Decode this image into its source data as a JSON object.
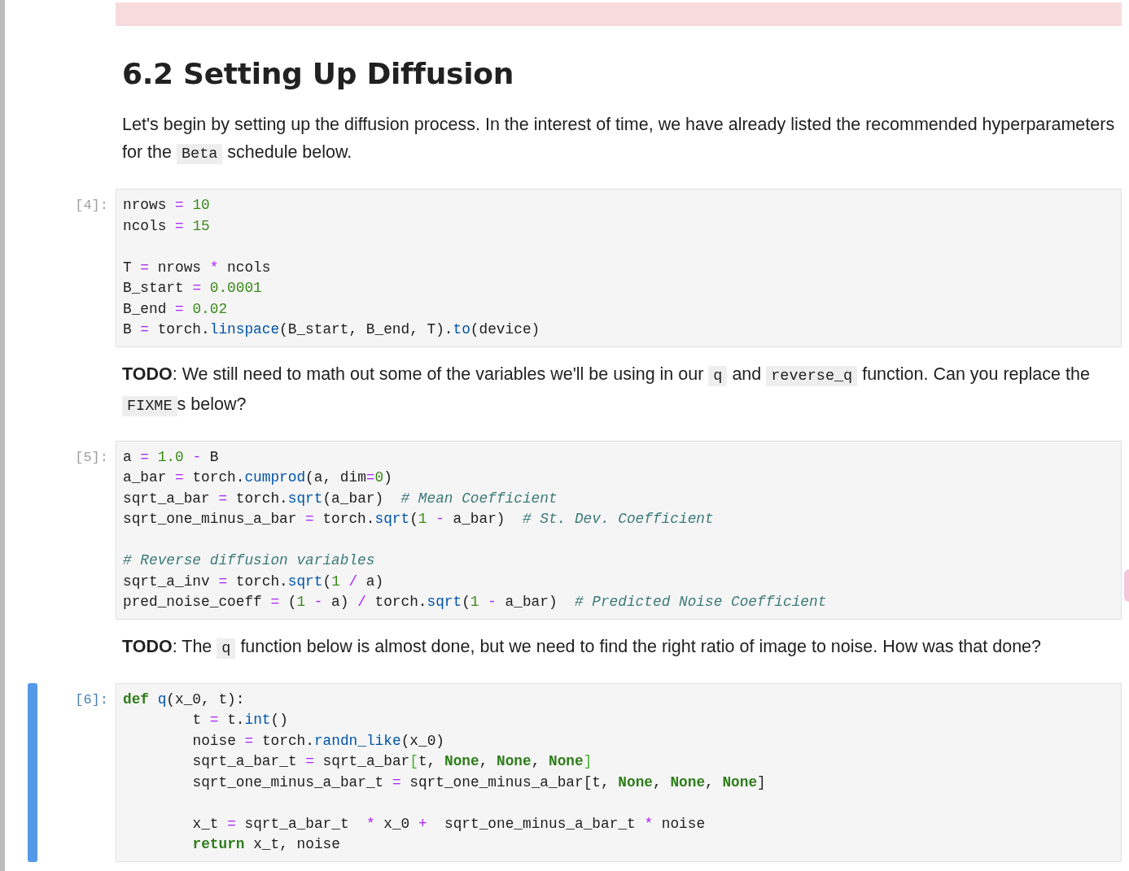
{
  "cells": [
    {
      "kind": "stderr_output",
      "selected": false
    },
    {
      "kind": "markdown",
      "selected": false,
      "heading": "6.2 Setting Up Diffusion",
      "paragraph": [
        {
          "kind": "text",
          "text": "Let's begin by setting up the diffusion process. In the interest of time, we have already listed the recommended hyperparameters for the "
        },
        {
          "kind": "code",
          "text": "Beta"
        },
        {
          "kind": "text",
          "text": " schedule below."
        }
      ]
    },
    {
      "kind": "code",
      "selected": false,
      "prompt": "[4]:",
      "lines": [
        {
          "tokens": [
            {
              "kind": "plain",
              "text": "nrows "
            },
            {
              "kind": "op",
              "text": "= "
            },
            {
              "kind": "number",
              "text": "10"
            }
          ]
        },
        {
          "tokens": [
            {
              "kind": "plain",
              "text": "ncols "
            },
            {
              "kind": "op",
              "text": "= "
            },
            {
              "kind": "number",
              "text": "15"
            }
          ]
        },
        {
          "blank_before": true,
          "tokens": [
            {
              "kind": "plain",
              "text": "T "
            },
            {
              "kind": "op",
              "text": "= "
            },
            {
              "kind": "plain",
              "text": "nrows "
            },
            {
              "kind": "op",
              "text": "* "
            },
            {
              "kind": "plain",
              "text": "ncols"
            }
          ]
        },
        {
          "tokens": [
            {
              "kind": "plain",
              "text": "B_start "
            },
            {
              "kind": "op",
              "text": "= "
            },
            {
              "kind": "number",
              "text": "0.0001"
            }
          ]
        },
        {
          "tokens": [
            {
              "kind": "plain",
              "text": "B_end "
            },
            {
              "kind": "op",
              "text": "= "
            },
            {
              "kind": "number",
              "text": "0.02"
            }
          ]
        },
        {
          "tokens": [
            {
              "kind": "plain",
              "text": "B "
            },
            {
              "kind": "op",
              "text": "= "
            },
            {
              "kind": "plain",
              "text": "torch."
            },
            {
              "kind": "func",
              "text": "linspace"
            },
            {
              "kind": "plain",
              "text": "(B_start, B_end, T)."
            },
            {
              "kind": "func",
              "text": "to"
            },
            {
              "kind": "plain",
              "text": "(device)"
            }
          ]
        }
      ]
    },
    {
      "kind": "markdown",
      "selected": false,
      "paragraph": [
        {
          "kind": "bold",
          "text": "TODO"
        },
        {
          "kind": "text",
          "text": ": We still need to math out some of the variables we'll be using in our "
        },
        {
          "kind": "code",
          "text": "q"
        },
        {
          "kind": "text",
          "text": " and "
        },
        {
          "kind": "code",
          "text": "reverse_q"
        },
        {
          "kind": "text",
          "text": " function. Can you replace the "
        },
        {
          "kind": "code",
          "text": "FIXME"
        },
        {
          "kind": "text",
          "text": "s below?"
        }
      ]
    },
    {
      "kind": "code",
      "selected": false,
      "prompt": "[5]:",
      "lines": [
        {
          "tokens": [
            {
              "kind": "plain",
              "text": "a "
            },
            {
              "kind": "op",
              "text": "= "
            },
            {
              "kind": "number",
              "text": "1.0 "
            },
            {
              "kind": "op",
              "text": "- "
            },
            {
              "kind": "plain",
              "text": "B"
            }
          ]
        },
        {
          "tokens": [
            {
              "kind": "plain",
              "text": "a_bar "
            },
            {
              "kind": "op",
              "text": "= "
            },
            {
              "kind": "plain",
              "text": "torch."
            },
            {
              "kind": "func",
              "text": "cumprod"
            },
            {
              "kind": "plain",
              "text": "(a, dim"
            },
            {
              "kind": "op",
              "text": "="
            },
            {
              "kind": "number",
              "text": "0"
            },
            {
              "kind": "plain",
              "text": ")"
            }
          ]
        },
        {
          "tokens": [
            {
              "kind": "plain",
              "text": "sqrt_a_bar "
            },
            {
              "kind": "op",
              "text": "= "
            },
            {
              "kind": "plain",
              "text": "torch."
            },
            {
              "kind": "func",
              "text": "sqrt"
            },
            {
              "kind": "plain",
              "text": "(a_bar)  "
            },
            {
              "kind": "comment",
              "text": "# Mean Coefficient"
            }
          ]
        },
        {
          "tokens": [
            {
              "kind": "plain",
              "text": "sqrt_one_minus_a_bar "
            },
            {
              "kind": "op",
              "text": "= "
            },
            {
              "kind": "plain",
              "text": "torch."
            },
            {
              "kind": "func",
              "text": "sqrt"
            },
            {
              "kind": "plain",
              "text": "("
            },
            {
              "kind": "number",
              "text": "1 "
            },
            {
              "kind": "op",
              "text": "- "
            },
            {
              "kind": "plain",
              "text": "a_bar)  "
            },
            {
              "kind": "comment",
              "text": "# St. Dev. Coefficient"
            }
          ]
        },
        {
          "blank_before": true,
          "tokens": [
            {
              "kind": "comment",
              "text": "# Reverse diffusion variables"
            }
          ]
        },
        {
          "tokens": [
            {
              "kind": "plain",
              "text": "sqrt_a_inv "
            },
            {
              "kind": "op",
              "text": "= "
            },
            {
              "kind": "plain",
              "text": "torch."
            },
            {
              "kind": "func",
              "text": "sqrt"
            },
            {
              "kind": "plain",
              "text": "("
            },
            {
              "kind": "number",
              "text": "1 "
            },
            {
              "kind": "op",
              "text": "/ "
            },
            {
              "kind": "plain",
              "text": "a)"
            }
          ]
        },
        {
          "tokens": [
            {
              "kind": "plain",
              "text": "pred_noise_coeff "
            },
            {
              "kind": "op",
              "text": "= "
            },
            {
              "kind": "plain",
              "text": "("
            },
            {
              "kind": "number",
              "text": "1 "
            },
            {
              "kind": "op",
              "text": "- "
            },
            {
              "kind": "plain",
              "text": "a) "
            },
            {
              "kind": "op",
              "text": "/ "
            },
            {
              "kind": "plain",
              "text": "torch."
            },
            {
              "kind": "func",
              "text": "sqrt"
            },
            {
              "kind": "plain",
              "text": "("
            },
            {
              "kind": "number",
              "text": "1 "
            },
            {
              "kind": "op",
              "text": "- "
            },
            {
              "kind": "plain",
              "text": "a_bar)  "
            },
            {
              "kind": "comment",
              "text": "# Predicted Noise Coefficient"
            }
          ]
        }
      ]
    },
    {
      "kind": "markdown",
      "selected": false,
      "paragraph": [
        {
          "kind": "bold",
          "text": "TODO"
        },
        {
          "kind": "text",
          "text": ": The "
        },
        {
          "kind": "code",
          "text": "q"
        },
        {
          "kind": "text",
          "text": " function below is almost done, but we need to find the right ratio of image to noise. How was that done?"
        }
      ]
    },
    {
      "kind": "code",
      "selected": true,
      "prompt": "[6]:",
      "lines": [
        {
          "tokens": [
            {
              "kind": "keyword",
              "text": "def "
            },
            {
              "kind": "func",
              "text": "q"
            },
            {
              "kind": "plain",
              "text": "(x_0, t):"
            }
          ]
        },
        {
          "indent": true,
          "tokens": [
            {
              "kind": "plain",
              "text": "t "
            },
            {
              "kind": "op",
              "text": "= "
            },
            {
              "kind": "plain",
              "text": "t."
            },
            {
              "kind": "func",
              "text": "int"
            },
            {
              "kind": "plain",
              "text": "()"
            }
          ]
        },
        {
          "indent": true,
          "tokens": [
            {
              "kind": "plain",
              "text": "noise "
            },
            {
              "kind": "op",
              "text": "= "
            },
            {
              "kind": "plain",
              "text": "torch."
            },
            {
              "kind": "func",
              "text": "randn_like"
            },
            {
              "kind": "plain",
              "text": "(x_0)"
            }
          ]
        },
        {
          "indent": true,
          "tokens": [
            {
              "kind": "plain",
              "text": "sqrt_a_bar_t "
            },
            {
              "kind": "op",
              "text": "= "
            },
            {
              "kind": "plain",
              "text": "sqrt_a_bar"
            },
            {
              "kind": "match",
              "text": "["
            },
            {
              "kind": "plain",
              "text": "t, "
            },
            {
              "kind": "keyword",
              "text": "None"
            },
            {
              "kind": "plain",
              "text": ", "
            },
            {
              "kind": "keyword",
              "text": "None"
            },
            {
              "kind": "plain",
              "text": ", "
            },
            {
              "kind": "keyword",
              "text": "None"
            },
            {
              "kind": "match",
              "text": "]"
            }
          ]
        },
        {
          "indent": true,
          "tokens": [
            {
              "kind": "plain",
              "text": "sqrt_one_minus_a_bar_t "
            },
            {
              "kind": "op",
              "text": "= "
            },
            {
              "kind": "plain",
              "text": "sqrt_one_minus_a_bar[t, "
            },
            {
              "kind": "keyword",
              "text": "None"
            },
            {
              "kind": "plain",
              "text": ", "
            },
            {
              "kind": "keyword",
              "text": "None"
            },
            {
              "kind": "plain",
              "text": ", "
            },
            {
              "kind": "keyword",
              "text": "None"
            },
            {
              "kind": "plain",
              "text": "]"
            }
          ]
        },
        {
          "indent": true,
          "blank_before": true,
          "tokens": [
            {
              "kind": "plain",
              "text": "x_t "
            },
            {
              "kind": "op",
              "text": "= "
            },
            {
              "kind": "plain",
              "text": "sqrt_a_bar_t  "
            },
            {
              "kind": "op",
              "text": "* "
            },
            {
              "kind": "plain",
              "text": "x_0 "
            },
            {
              "kind": "op",
              "text": "+  "
            },
            {
              "kind": "plain",
              "text": "sqrt_one_minus_a_bar_t "
            },
            {
              "kind": "op",
              "text": "* "
            },
            {
              "kind": "plain",
              "text": "noise"
            }
          ]
        },
        {
          "indent": true,
          "tokens": [
            {
              "kind": "keyword",
              "text": "return "
            },
            {
              "kind": "plain",
              "text": "x_t, noise"
            }
          ]
        }
      ]
    }
  ]
}
